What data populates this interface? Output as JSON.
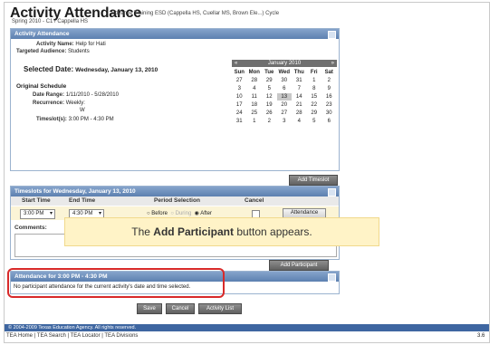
{
  "header": {
    "title": "Activity Attendance",
    "subtitle": "Edvance Training ESD (Cappella HS, Cuellar MS, Brown Ele...) Cycle",
    "season": "Spring 2010 - C1 / Cappella HS"
  },
  "attendance_panel": {
    "title": "Activity Attendance",
    "activity_name_label": "Activity Name:",
    "activity_name": "Help for Hati",
    "audience_label": "Targeted Audience:",
    "audience": "Students",
    "selected_date_label": "Selected Date:",
    "selected_date": "Wednesday, January 13, 2010",
    "original_schedule": "Original Schedule",
    "date_range_label": "Date Range:",
    "date_range": "1/11/2010 - 5/28/2010",
    "recurrence_label": "Recurrence:",
    "recurrence_line1": "Weekly:",
    "recurrence_line2": "W",
    "timeslots_label": "Timeslot(s):",
    "timeslots": "3:00 PM - 4:30 PM"
  },
  "calendar": {
    "month": "January 2010",
    "prev": "«",
    "next": "»",
    "days": [
      "Sun",
      "Mon",
      "Tue",
      "Wed",
      "Thu",
      "Fri",
      "Sat"
    ],
    "weeks": [
      [
        "27",
        "28",
        "29",
        "30",
        "31",
        "1",
        "2"
      ],
      [
        "3",
        "4",
        "5",
        "6",
        "7",
        "8",
        "9"
      ],
      [
        "10",
        "11",
        "12",
        "13",
        "14",
        "15",
        "16"
      ],
      [
        "17",
        "18",
        "19",
        "20",
        "21",
        "22",
        "23"
      ],
      [
        "24",
        "25",
        "26",
        "27",
        "28",
        "29",
        "30"
      ],
      [
        "31",
        "1",
        "2",
        "3",
        "4",
        "5",
        "6"
      ]
    ],
    "selected_day": "13"
  },
  "buttons": {
    "add_timeslot": "Add Timeslot",
    "attendance": "Attendance",
    "add_participant": "Add Participant",
    "save": "Save",
    "cancel": "Cancel",
    "activity_list": "Activity List"
  },
  "timeslots_panel": {
    "title": "Timeslots for Wednesday, January 13, 2010",
    "col_start": "Start Time",
    "col_end": "End Time",
    "col_period": "Period Selection",
    "col_cancel": "Cancel",
    "start_value": "3:00 PM",
    "end_value": "4:30 PM",
    "radio_before": "Before",
    "radio_during": "During",
    "radio_after": "After",
    "comments_label": "Comments:"
  },
  "callout": {
    "prefix": "The ",
    "bold": "Add Participant",
    "suffix": " button appears."
  },
  "attendance_time_panel": {
    "title": "Attendance for 3:00 PM - 4:30 PM",
    "message": "No participant attendance for the current activity's date and time selected."
  },
  "footer": {
    "copyright": "© 2004-2009 Texas Education Agency. All rights reserved.",
    "links": "TEA Home | TEA Search | TEA Locator | TEA Divisions",
    "version": "3.6"
  },
  "colors": {
    "panel_header": "#5c80b0",
    "highlight": "#d82a2a",
    "callout_bg": "#fff3c7"
  }
}
